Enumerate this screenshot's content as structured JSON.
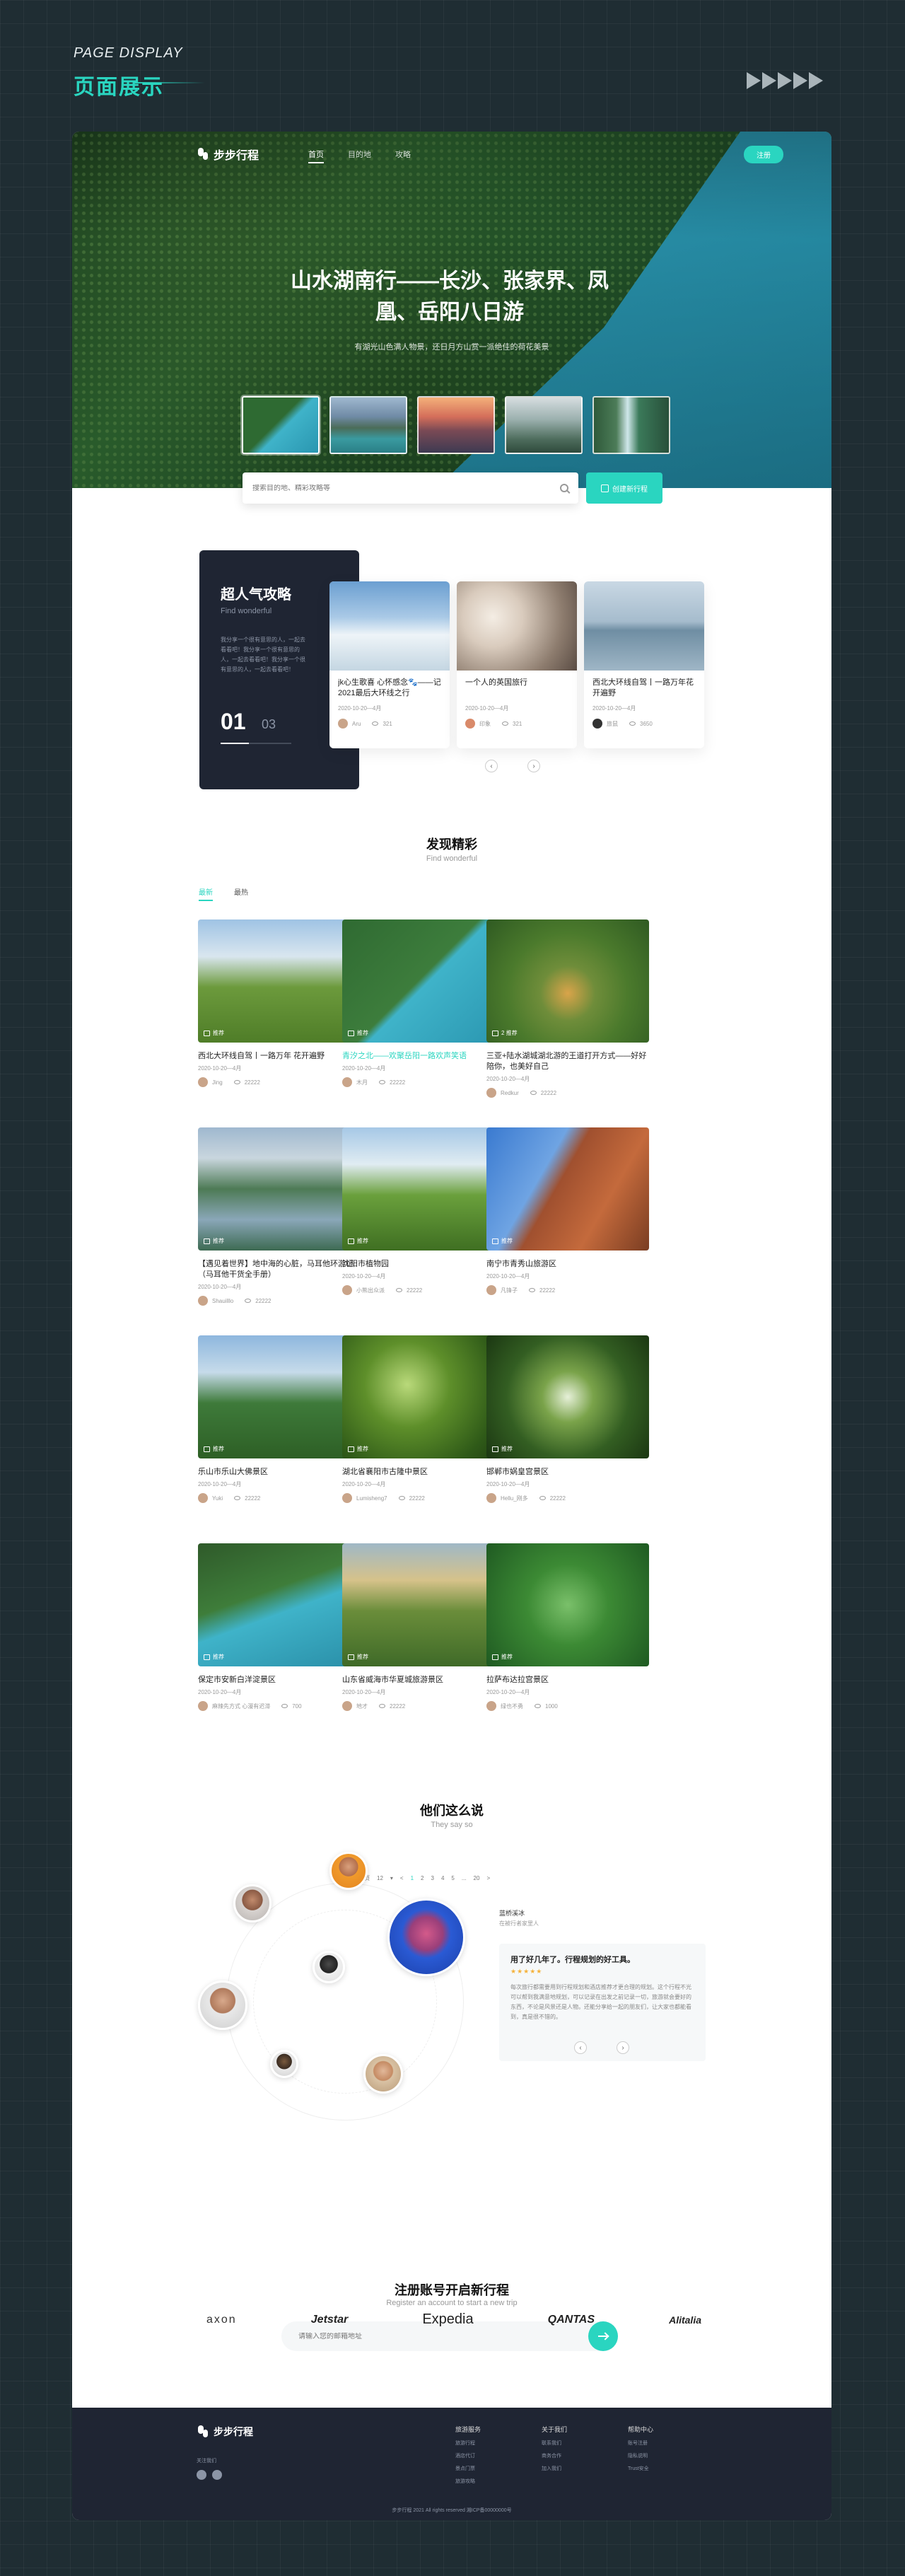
{
  "page": {
    "subtitle": "PAGE DISPLAY",
    "title": "页面展示"
  },
  "nav": {
    "logo": "步步行程",
    "links": [
      "首页",
      "目的地",
      "攻略"
    ],
    "login": "注册"
  },
  "hero": {
    "title": "山水湖南行——长沙、张家界、凤凰、岳阳八日游",
    "desc": "有湖光山色满人物景，还日月方山赏一派绝佳的荷花美景",
    "search_placeholder": "搜索目的地、精彩攻略等",
    "create_btn": "创建新行程"
  },
  "popular": {
    "title": "超人气攻略",
    "sub": "Find wonderful",
    "desc": "我分享一个很有意思的人，一起去看看吧！我分享一个很有意思的人，一起去看看吧！我分享一个很有意思的人，一起去看看吧！",
    "current": "01",
    "total": "03",
    "cards": [
      {
        "title": "jk心生歌喜 心怀感念🐾——记2021最后大环线之行",
        "date": "2020-10-20—4月",
        "author": "Aru",
        "views": "321"
      },
      {
        "title": "一个人的英国旅行",
        "date": "2020-10-20—4月",
        "author": "印象",
        "views": "321"
      },
      {
        "title": "西北大环线自驾丨一路万年花开遍野",
        "date": "2020-10-20—4月",
        "author": "旅鼠",
        "views": "3650"
      }
    ]
  },
  "discover": {
    "title": "发现精彩",
    "sub": "Find wonderful",
    "tabs": [
      "最新",
      "最热"
    ],
    "items": [
      {
        "title": "西北大环线自驾丨一路万年 花开遍野",
        "date": "2020-10-20—4月",
        "author": "Jing",
        "views": "22222",
        "tag": "推荐",
        "hl": false
      },
      {
        "title": "青汐之北——欢聚岳阳一路欢声笑语",
        "date": "2020-10-20—4月",
        "author": "木月",
        "views": "22222",
        "tag": "推荐",
        "hl": true
      },
      {
        "title": "三亚+陆水湖城湖北游的王道打开方式——好好陪你，也美好自己",
        "date": "2020-10-20—4月",
        "author": "Redkur",
        "views": "22222",
        "tag": "2 推荐",
        "hl": false
      },
      {
        "title": "【遇见着世界】地中海的心脏，马耳他环游记（马耳他干货全手册）",
        "date": "2020-10-20—4月",
        "author": "Shauilllo",
        "views": "22222",
        "tag": "推荐",
        "hl": false
      },
      {
        "title": "沈阳市植物园",
        "date": "2020-10-20—4月",
        "author": "小熊出众派",
        "views": "22222",
        "tag": "推荐",
        "hl": false
      },
      {
        "title": "南宁市青秀山旅游区",
        "date": "2020-10-20—4月",
        "author": "凡锋子",
        "views": "22222",
        "tag": "推荐",
        "hl": false
      },
      {
        "title": "乐山市乐山大佛景区",
        "date": "2020-10-20—4月",
        "author": "Yuki",
        "views": "22222",
        "tag": "推荐",
        "hl": false
      },
      {
        "title": "湖北省襄阳市古隆中景区",
        "date": "2020-10-20—4月",
        "author": "Lumisheng7",
        "views": "22222",
        "tag": "推荐",
        "hl": false
      },
      {
        "title": "邯郸市娲皇宫景区",
        "date": "2020-10-20—4月",
        "author": "Hellu_刚多",
        "views": "22222",
        "tag": "推荐",
        "hl": false
      },
      {
        "title": "保定市安新白洋淀景区",
        "date": "2020-10-20—4月",
        "author": "麻辣先方式 心漫有迟滞",
        "views": "700",
        "tag": "推荐",
        "hl": false
      },
      {
        "title": "山东省威海市华夏城旅游景区",
        "date": "2020-10-20—4月",
        "author": "地才",
        "views": "22222",
        "tag": "推荐",
        "hl": false
      },
      {
        "title": "拉萨布达拉宫景区",
        "date": "2020-10-20—4月",
        "author": "绿也不勇",
        "views": "1000",
        "tag": "推荐",
        "hl": false
      }
    ]
  },
  "pagination": {
    "label": "每页",
    "per": "12",
    "pages": [
      "<",
      "1",
      "2",
      "3",
      "4",
      "5",
      "...",
      "20",
      ">"
    ],
    "current": "1"
  },
  "testimonials": {
    "title": "他们这么说",
    "sub": "They say so",
    "name": "蓝桥溪冰",
    "role": "在被行者家里人",
    "quote_title": "用了好几年了。行程规划的好工具。",
    "stars": "★★★★★",
    "quote": "每次旅行都需要用到行程规划和酒店推荐才更合理的规划。这个行程不光可以帮到我满意地规划，可以记录在出发之前记录一切，旅游就会要好的东西，不论是风景还是人物。还能分享给一起的朋友们，让大家也都能看到，真是很不错的。"
  },
  "register": {
    "title": "注册账号开启新行程",
    "sub": "Register an account to start a new trip",
    "placeholder": "请输入您的邮箱地址"
  },
  "brands": [
    "axon",
    "Jetstar",
    "Expedia",
    "QANTAS",
    "Alitalia"
  ],
  "footer": {
    "logo": "步步行程",
    "follow": "关注我们",
    "cols": [
      {
        "title": "旅游服务",
        "items": [
          "旅游行程",
          "酒店代订",
          "景点门票",
          "旅游攻略"
        ]
      },
      {
        "title": "关于我们",
        "items": [
          "联系我们",
          "商务合作",
          "加入我们"
        ]
      },
      {
        "title": "帮助中心",
        "items": [
          "账号注册",
          "隐私说明",
          "Trust安全"
        ]
      }
    ],
    "copyright": "步步行程 2021 All rights reserved 湘ICP备00000000号"
  },
  "colors": {
    "accent": "#2ad5c0",
    "dark": "#1f2533",
    "bg": "#1f2d33"
  }
}
